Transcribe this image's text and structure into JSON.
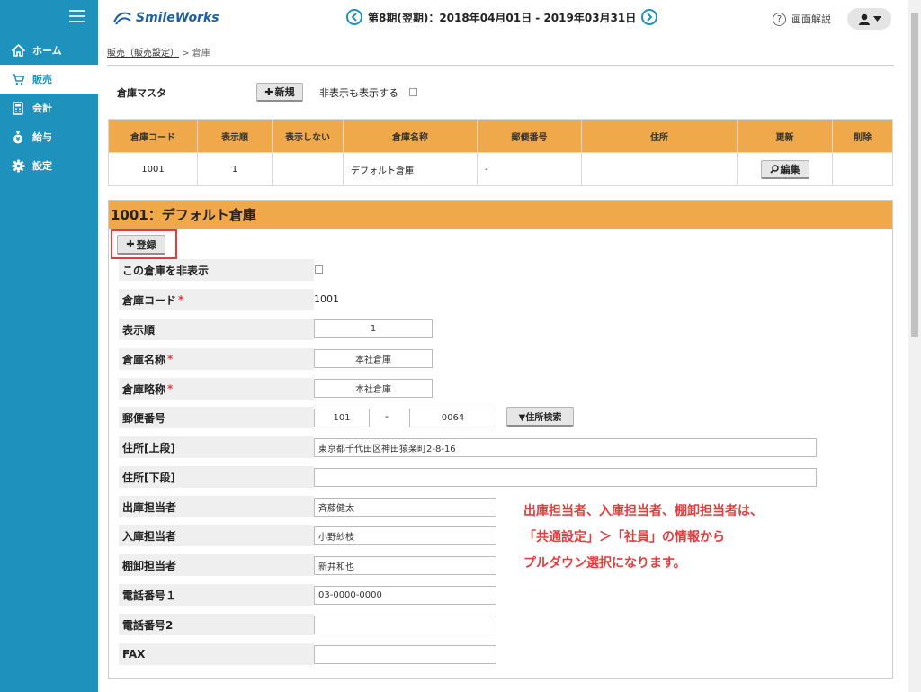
{
  "sidebar": {
    "items": [
      {
        "label": "ホーム",
        "icon": "home-icon"
      },
      {
        "label": "販売",
        "icon": "cart-icon"
      },
      {
        "label": "会計",
        "icon": "calculator-icon"
      },
      {
        "label": "給与",
        "icon": "money-bag-icon"
      },
      {
        "label": "設定",
        "icon": "gear-icon"
      }
    ]
  },
  "header": {
    "logo_text": "SmileWorks",
    "period": "第8期(翌期)：2018年04月01日 - 2019年03月31日",
    "help_label": "画面解説"
  },
  "breadcrumb": {
    "parent": "販売（販売設定）",
    "separator": ">",
    "current": "倉庫"
  },
  "master": {
    "title": "倉庫マスタ",
    "new_button": "新規",
    "show_hidden_label": "非表示も表示する"
  },
  "table": {
    "columns": [
      "倉庫コード",
      "表示順",
      "表示しない",
      "倉庫名称",
      "郵便番号",
      "住所",
      "更新",
      "削除"
    ],
    "rows": [
      {
        "code": "1001",
        "order": "1",
        "hidden": "",
        "name": "デフォルト倉庫",
        "postal": "-",
        "address": "",
        "edit_label": "編集",
        "delete": ""
      }
    ]
  },
  "detail": {
    "title": "1001：デフォルト倉庫",
    "register_button": "登録",
    "hide_label": "この倉庫を非表示",
    "code_label": "倉庫コード",
    "code_value": "1001",
    "order_label": "表示順",
    "order_value": "1",
    "name_label": "倉庫名称",
    "name_value": "本社倉庫",
    "short_label": "倉庫略称",
    "short_value": "本社倉庫",
    "postal_label": "郵便番号",
    "postal1": "101",
    "postal_sep": "-",
    "postal2": "0064",
    "address_search_button": "▼住所検索",
    "addr_upper_label": "住所[上段]",
    "addr_upper_value": "東京都千代田区神田猿楽町2-8-16",
    "addr_lower_label": "住所[下段]",
    "addr_lower_value": "",
    "out_label": "出庫担当者",
    "out_value": "斉藤健太",
    "in_label": "入庫担当者",
    "in_value": "小野紗枝",
    "inv_label": "棚卸担当者",
    "inv_value": "新井和也",
    "tel1_label": "電話番号１",
    "tel1_value": "03-0000-0000",
    "tel2_label": "電話番号2",
    "tel2_value": "",
    "fax_label": "FAX",
    "fax_value": ""
  },
  "annotation": {
    "line1": "出庫担当者、入庫担当者、棚卸担当者は、",
    "line2": "「共通設定」＞「社員」の情報から",
    "line3": "プルダウン選択になります。"
  },
  "colors": {
    "sidebar": "#1e92bd",
    "table_header": "#f0a94a",
    "required": "#e53c3c"
  }
}
